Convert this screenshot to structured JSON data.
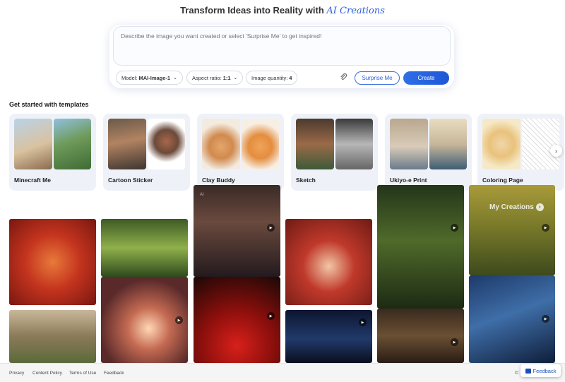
{
  "hero": {
    "title_prefix": "Transform Ideas into Reality with",
    "title_accent": "AI Creations"
  },
  "prompt": {
    "placeholder": "Describe the image you want created or select 'Surprise Me' to get inspired!",
    "model_label": "Model:",
    "model_value": "MAI-Image-1",
    "aspect_label": "Aspect ratio:",
    "aspect_value": "1:1",
    "quantity_label": "Image quantity:",
    "quantity_value": "4",
    "surprise_label": "Surprise Me",
    "create_label": "Create"
  },
  "templates": {
    "title": "Get started with templates",
    "items": [
      {
        "label": "Minecraft Me"
      },
      {
        "label": "Cartoon Sticker"
      },
      {
        "label": "Clay Buddy"
      },
      {
        "label": "Sketch"
      },
      {
        "label": "Ukiyo-e Print"
      },
      {
        "label": "Coloring Page"
      }
    ]
  },
  "gallery": {
    "ai_badge": "AI",
    "my_creations": "My Creations"
  },
  "footer": {
    "links": [
      "Privacy",
      "Content Policy",
      "Terms of Use",
      "Feedback"
    ],
    "copyright": "©",
    "feedback_button": "Feedback"
  },
  "colors": {
    "accent": "#2b5fd9",
    "create_button": "#1d57d6",
    "card_bg": "#eef2f8"
  },
  "icons": [
    "chevron-down-icon",
    "paperclip-icon",
    "chevron-right-icon",
    "play-icon",
    "feedback-icon"
  ]
}
